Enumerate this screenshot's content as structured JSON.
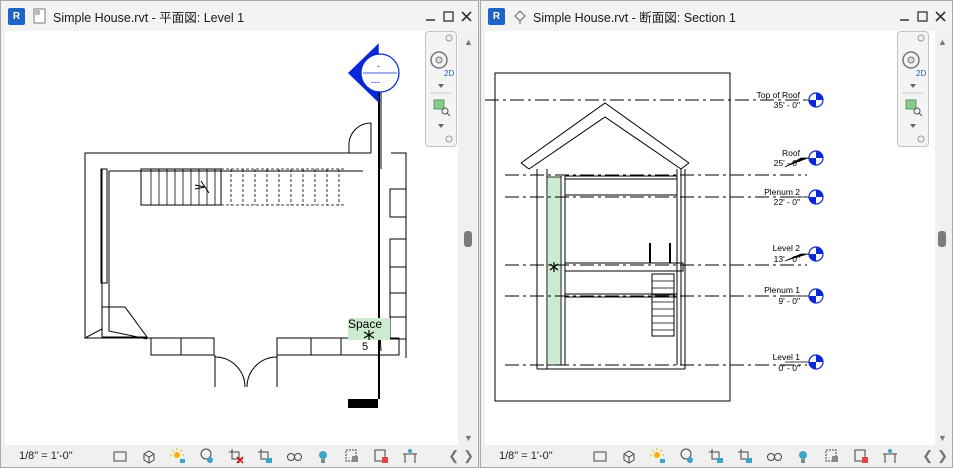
{
  "left_window": {
    "app_badge": "R",
    "title": "Simple House.rvt - 平面図: Level 1",
    "scale": "1/8\" = 1'-0\"",
    "room_tag": {
      "name": "Space",
      "number": "5"
    },
    "elevation_marker": {
      "top": "-",
      "bottom": "---"
    }
  },
  "right_window": {
    "app_badge": "R",
    "title": "Simple House.rvt - 断面図: Section 1",
    "scale": "1/8\" = 1'-0\"",
    "levels": [
      {
        "name": "Top of Roof",
        "elevation": "35' - 0\""
      },
      {
        "name": "Roof",
        "elevation": "25' - 0\""
      },
      {
        "name": "Plenum 2",
        "elevation": "22' - 0\""
      },
      {
        "name": "Level 2",
        "elevation": "13' - 0\""
      },
      {
        "name": "Plenum 1",
        "elevation": "9' - 0\""
      },
      {
        "name": "Level 1",
        "elevation": "0' - 0\""
      }
    ]
  },
  "nav_widget": {
    "label_2d": "2D"
  },
  "icons": {
    "window_buttons": [
      "minimize-icon",
      "maximize-icon",
      "close-icon"
    ],
    "status_bar": [
      "detail-level-icon",
      "visual-style-icon",
      "sun-path-icon",
      "shadows-icon",
      "crop-view-icon",
      "show-crop-icon",
      "temporary-hide-icon",
      "reveal-hidden-icon",
      "temporary-view-properties-icon",
      "worksharing-icon",
      "analytical-model-icon",
      "constraints-icon"
    ]
  },
  "colors": {
    "accent": "#1e63c8",
    "space_fill": "#cdeccf",
    "level_head": "#0a28d8"
  }
}
